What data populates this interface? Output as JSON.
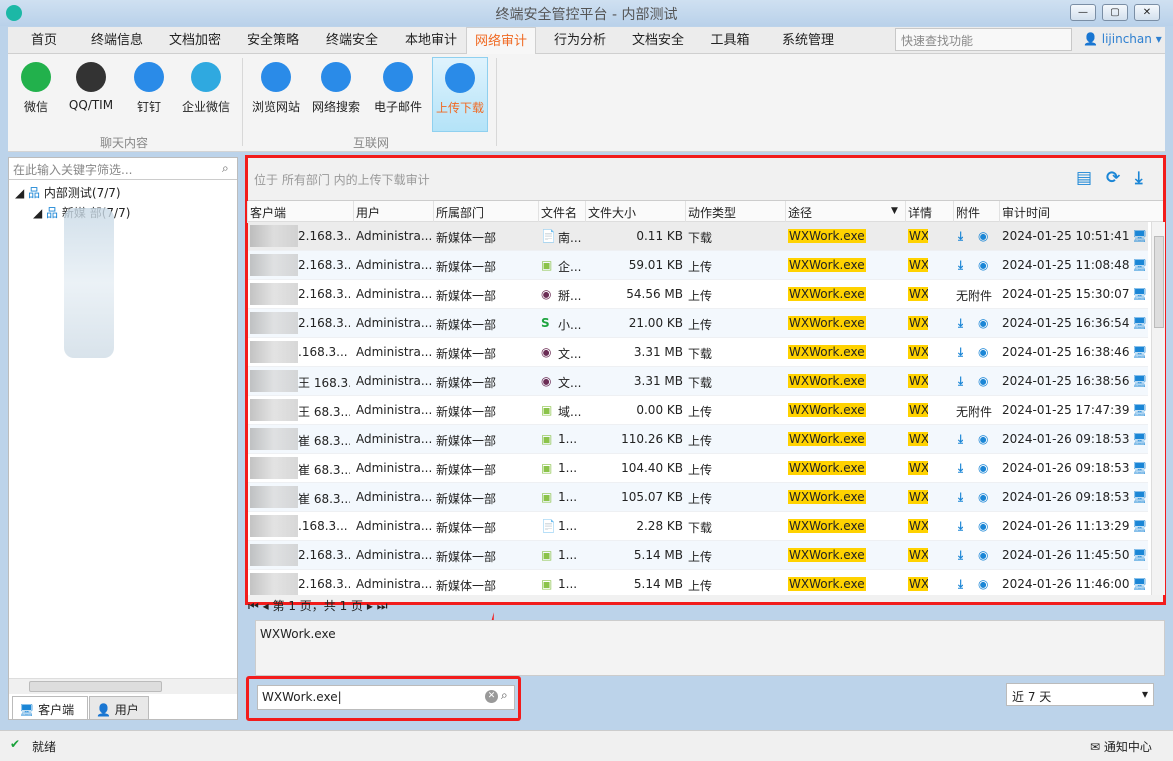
{
  "window": {
    "title": "终端安全管控平台 - 内部测试",
    "min": "—",
    "max": "▢",
    "close": "✕"
  },
  "menu": [
    "首页",
    "终端信息",
    "文档加密",
    "安全策略",
    "终端安全",
    "本地审计",
    "网络审计",
    "行为分析",
    "文档安全",
    "工具箱",
    "系统管理"
  ],
  "active_menu": "网络审计",
  "quick_search_placeholder": "快速查找功能",
  "user": "lijinchan",
  "ribbon": {
    "groups": [
      "聊天内容",
      "互联网"
    ],
    "items": [
      "微信",
      "QQ/TIM",
      "钉钉",
      "企业微信",
      "浏览网站",
      "网络搜索",
      "电子邮件",
      "上传下载"
    ],
    "active": "上传下载"
  },
  "left": {
    "filter_placeholder": "在此输入关键字筛选...",
    "root": "内部测试(7/7)",
    "dept": "新媒 部(7/7)",
    "tabs": [
      "客户端",
      "用户"
    ]
  },
  "main": {
    "location": "位于 所有部门 内的上传下载审计",
    "columns": [
      "客户端",
      "用户",
      "所属部门",
      "文件名",
      "文件大小",
      "动作类型",
      "途径",
      "详情",
      "附件",
      "审计时间"
    ],
    "rows": [
      [
        "2.168.3...",
        "Administra...",
        "新媒体一部",
        "南...",
        "0.11 KB",
        "下载",
        "WXWork.exe",
        "WX...",
        "att",
        "2024-01-25 10:51:41",
        "doc"
      ],
      [
        "2.168.3...",
        "Administra...",
        "新媒体一部",
        "企...",
        "59.01 KB",
        "上传",
        "WXWork.exe",
        "WX...",
        "att",
        "2024-01-25 11:08:48",
        "png"
      ],
      [
        "2.168.3...",
        "Administra...",
        "新媒体一部",
        "掰...",
        "54.56 MB",
        "上传",
        "WXWork.exe",
        "WX...",
        "无附件",
        "2024-01-25 15:30:07",
        "video"
      ],
      [
        "2.168.3...",
        "Administra...",
        "新媒体一部",
        "小...",
        "21.00 KB",
        "上传",
        "WXWork.exe",
        "WX...",
        "att",
        "2024-01-25 16:36:54",
        "sheet"
      ],
      [
        ".168.3...",
        "Administra...",
        "新媒体一部",
        "文...",
        "3.31 MB",
        "下载",
        "WXWork.exe",
        "WX...",
        "att",
        "2024-01-25 16:38:46",
        "video"
      ],
      [
        "王 168.3...",
        "Administra...",
        "新媒体一部",
        "文...",
        "3.31 MB",
        "下载",
        "WXWork.exe",
        "WX...",
        "att",
        "2024-01-25 16:38:56",
        "video"
      ],
      [
        "王 68.3...",
        "Administra...",
        "新媒体一部",
        "域...",
        "0.00 KB",
        "上传",
        "WXWork.exe",
        "WX...",
        "无附件",
        "2024-01-25 17:47:39",
        "png"
      ],
      [
        "崔 68.3...",
        "Administra...",
        "新媒体一部",
        "1...",
        "110.26 KB",
        "上传",
        "WXWork.exe",
        "WX...",
        "att",
        "2024-01-26 09:18:53",
        "png"
      ],
      [
        "崔 68.3...",
        "Administra...",
        "新媒体一部",
        "1...",
        "104.40 KB",
        "上传",
        "WXWork.exe",
        "WX...",
        "att",
        "2024-01-26 09:18:53",
        "png"
      ],
      [
        "崔 68.3...",
        "Administra...",
        "新媒体一部",
        "1...",
        "105.07 KB",
        "上传",
        "WXWork.exe",
        "WX...",
        "att",
        "2024-01-26 09:18:53",
        "png"
      ],
      [
        ".168.3...",
        "Administra...",
        "新媒体一部",
        "1...",
        "2.28 KB",
        "下载",
        "WXWork.exe",
        "WX...",
        "att",
        "2024-01-26 11:13:29",
        "doc"
      ],
      [
        "2.168.3...",
        "Administra...",
        "新媒体一部",
        "1...",
        "5.14 MB",
        "上传",
        "WXWork.exe",
        "WX...",
        "att",
        "2024-01-26 11:45:50",
        "png"
      ],
      [
        "2.168.3...",
        "Administra...",
        "新媒体一部",
        "1...",
        "5.14 MB",
        "上传",
        "WXWork.exe",
        "WX...",
        "att",
        "2024-01-26 11:46:00",
        "png"
      ]
    ],
    "pager": "第 1 页，共 1 页",
    "detail": "WXWork.exe",
    "search_value": "WXWork.exe",
    "range": "近 7 天"
  },
  "status": {
    "text": "就绪",
    "notify": "通知中心"
  },
  "colors": {
    "accent": "#f06a23",
    "highlight": "#ffd200",
    "icon_blue": "#1b86d6",
    "annotation": "#f21c1c"
  }
}
